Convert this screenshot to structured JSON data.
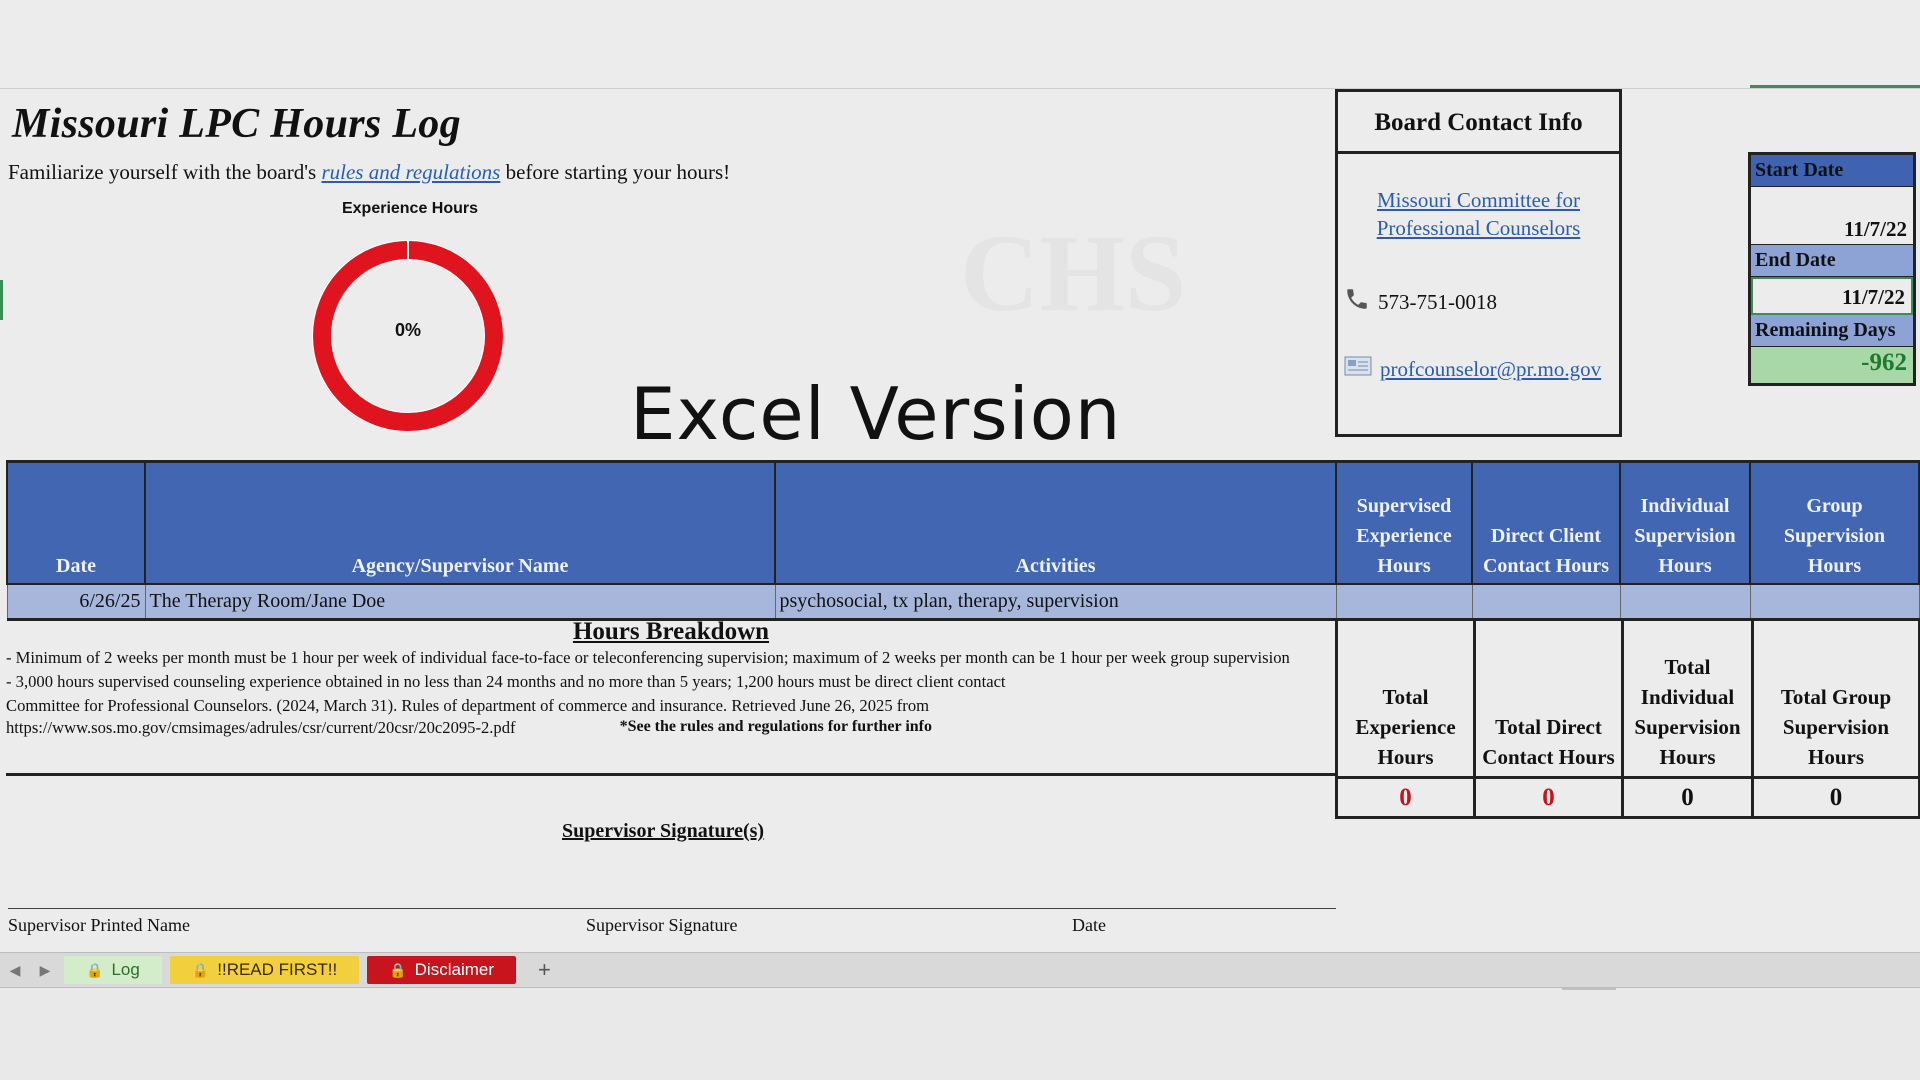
{
  "header": {
    "title": "Missouri LPC Hours Log",
    "intro_before": "Familiarize yourself with the board's",
    "intro_link": "rules and regulations",
    "intro_after": "before starting your hours!"
  },
  "chart_data": {
    "type": "pie",
    "title": "Experience Hours",
    "center_label": "0%",
    "values": [
      0,
      100
    ],
    "colors": [
      "#ffffff",
      "#e0141e"
    ]
  },
  "overlay": {
    "excel_version": "Excel Version",
    "watermark": "CHS"
  },
  "contact": {
    "title": "Board Contact Info",
    "committee_link": "Missouri Committee for Professional Counselors",
    "phone": "573-751-0018",
    "email": "profcounselor@pr.mo.gov",
    "phone_icon": "phone-icon",
    "email_icon": "mail-icon"
  },
  "dates": {
    "start_label": "Start Date",
    "start_value": "11/7/22",
    "end_label": "End Date",
    "end_value": "11/7/22",
    "remaining_label": "Remaining Days",
    "remaining_value": "-962"
  },
  "log": {
    "headers": [
      "Date",
      "Agency/Supervisor Name",
      "Activities",
      "Supervised Experience Hours",
      "Direct Client Contact Hours",
      "Individual Supervision Hours",
      "Group Supervision Hours"
    ],
    "rows": [
      {
        "date": "6/26/25",
        "agency": "The Therapy Room/Jane Doe",
        "activities": "psychosocial, tx plan, therapy, supervision",
        "supervised": "",
        "direct": "",
        "individual": "",
        "group": ""
      }
    ]
  },
  "breakdown": {
    "title": "Hours Breakdown",
    "line1": "- Minimum of 2 weeks per month must be 1 hour per week of individual face-to-face or teleconferencing supervision; maximum of 2 weeks per month can be 1 hour per week group supervision",
    "line2": "- 3,000 hours supervised counseling experience obtained in no less than 24 months and no more than 5 years; 1,200 hours must be direct client contact",
    "line3": "Committee for Professional Counselors. (2024, March 31). Rules of department of commerce and insurance. Retrieved June 26, 2025 from",
    "url": "https://www.sos.mo.gov/cmsimages/adrules/csr/current/20csr/20c2095-2.pdf",
    "note": "*See the rules and regulations for further info"
  },
  "totals": {
    "headers": [
      "Total Experience Hours",
      "Total Direct Contact Hours",
      "Total Individual Supervision Hours",
      "Total Group Supervision Hours"
    ],
    "values": [
      "0",
      "0",
      "0",
      "0"
    ],
    "red_color": "#c8141c"
  },
  "signature": {
    "title": "Supervisor Signature(s)",
    "printed_name": "Supervisor Printed Name",
    "signature": "Supervisor Signature",
    "date": "Date"
  },
  "tabs": {
    "log": "Log",
    "read_first": "!!READ FIRST!!",
    "disclaimer": "Disclaimer",
    "add": "+"
  }
}
